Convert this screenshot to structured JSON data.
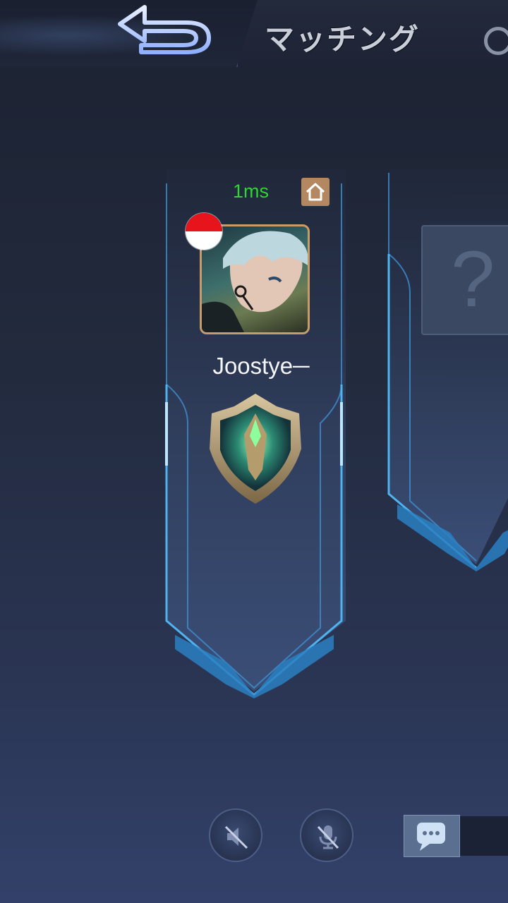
{
  "header": {
    "title": "マッチング",
    "back_icon": "back-arrow-icon"
  },
  "slots": [
    {
      "ping": "1ms",
      "ping_color": "#2fd62f",
      "player_name": "Joostye─",
      "flag": "indonesia-flag",
      "room_icon": "home-icon",
      "rank": "rank-badge-icon"
    },
    {
      "placeholder": "?"
    }
  ],
  "controls": {
    "speaker_icon": "speaker-muted-icon",
    "mic_icon": "mic-muted-icon",
    "chat_icon": "chat-bubble-icon"
  },
  "colors": {
    "frame_glow": "#3fa6e6",
    "avatar_border": "#c79b6a"
  }
}
